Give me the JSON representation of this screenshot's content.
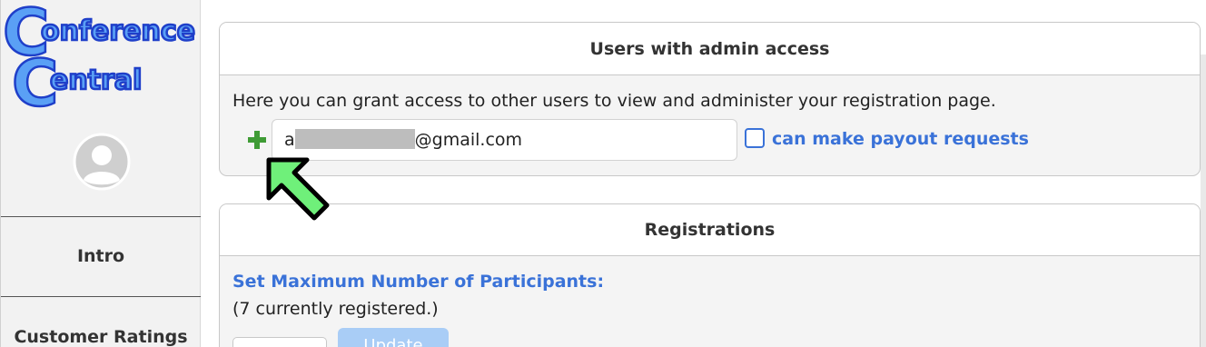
{
  "sidebar": {
    "logo_line1": "onference",
    "logo_line2": "entral",
    "logo_letter": "C",
    "items": [
      {
        "label": "Intro"
      },
      {
        "label": "Customer Ratings"
      }
    ]
  },
  "admin_card": {
    "title": "Users with admin access",
    "description": "Here you can grant access to other users to view and administer your registration page.",
    "email_prefix": "a",
    "email_suffix": "@gmail.com",
    "checkbox_label": "can make payout requests",
    "checkbox_checked": false
  },
  "registrations_card": {
    "title": "Registrations",
    "max_label": "Set Maximum Number of Participants:",
    "registered_text": "(7 currently registered.)",
    "update_label": "Update"
  },
  "colors": {
    "accent": "#3a72d8",
    "plus": "#3f9b35",
    "arrow": "#6ff07a",
    "logo_fill": "#5aa0f5",
    "logo_stroke": "#1f3fc9"
  }
}
